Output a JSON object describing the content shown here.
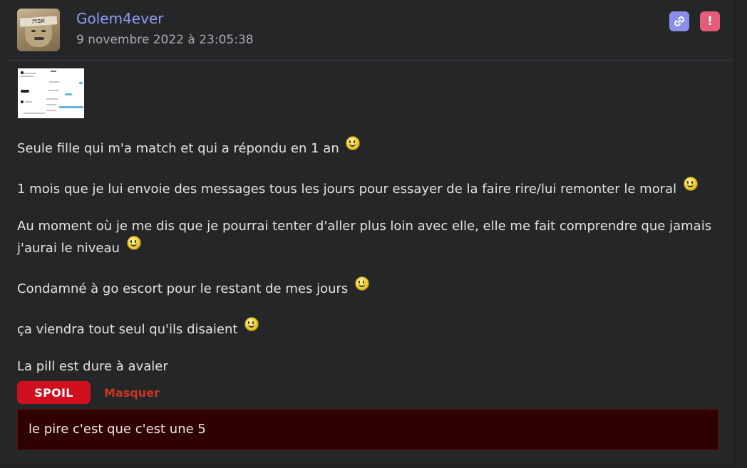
{
  "post": {
    "username": "Golem4ever",
    "timestamp": "9 novembre 2022 à 23:05:38",
    "avatar_caption": "אבות",
    "actions": [
      {
        "name": "permalink-button",
        "icon": "link-icon",
        "color": "#8c8fea"
      },
      {
        "name": "report-button",
        "icon": "exclamation-icon",
        "label": "!",
        "color": "#e55b7a"
      }
    ],
    "attachment_icon": "screenshot-thumbnail",
    "paragraphs": [
      {
        "text": "Seule fille qui m'a match et qui a répondu en 1 an",
        "emoji": "smiley-icon"
      },
      {
        "text": "1 mois que je lui envoie des messages tous les jours pour essayer de la faire rire/lui remonter le moral",
        "emoji": "smiley-icon"
      },
      {
        "text": "Au moment où je me dis que je pourrai tenter d'aller plus loin avec elle, elle me fait comprendre que jamais j'aurai le niveau",
        "emoji": "smiley-icon"
      },
      {
        "text": "Condamné à go escort pour le restant de mes jours",
        "emoji": "smiley-icon"
      },
      {
        "text": "ça viendra tout seul qu'ils disaient",
        "emoji": "smiley-icon"
      },
      {
        "text": "La pill est dure à avaler",
        "emoji": null
      }
    ],
    "spoiler": {
      "label": "SPOIL",
      "toggle_label": "Masquer",
      "content": "le pire c'est que c'est une 5"
    }
  },
  "colors": {
    "background": "#252628",
    "username": "#8f9df5",
    "spoil_button": "#d0101e",
    "spoil_box": "#300000",
    "masquer": "#c9361f"
  }
}
